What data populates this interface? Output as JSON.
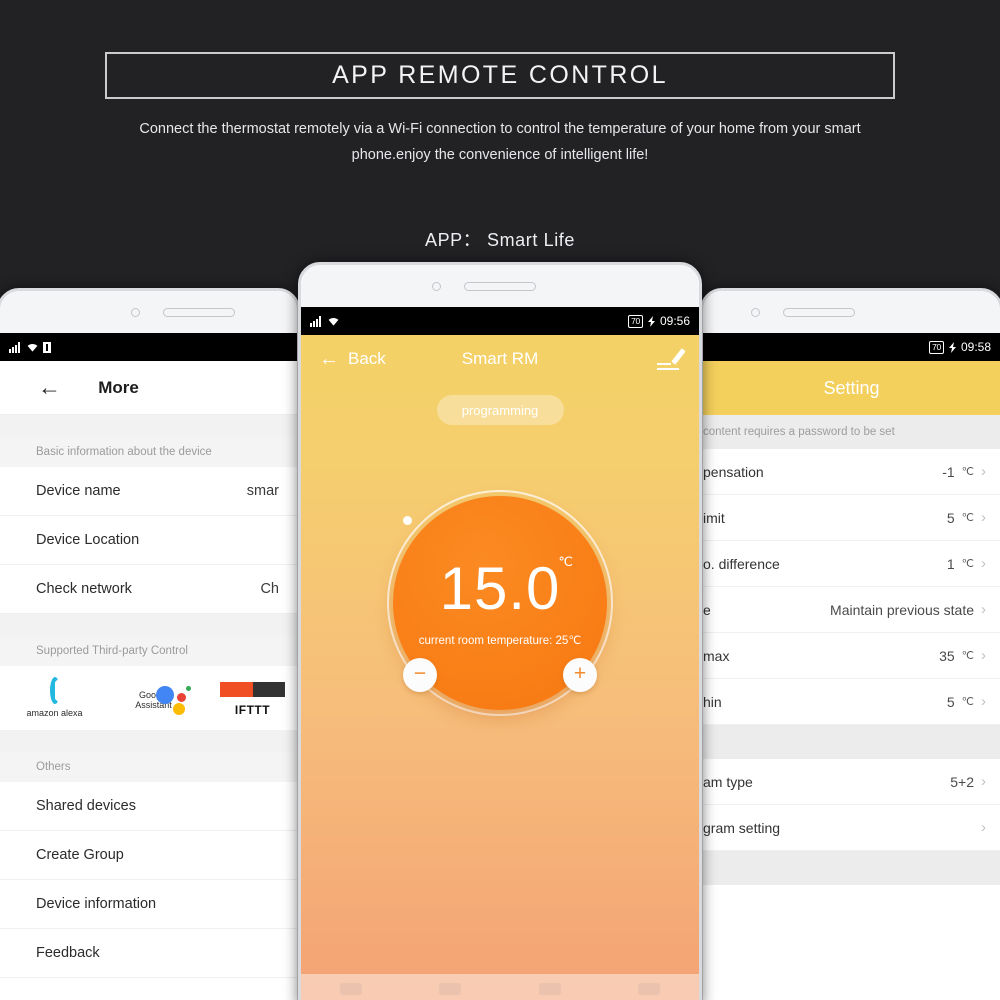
{
  "header": {
    "title": "APP REMOTE CONTROL",
    "subtitle": "Connect the thermostat remotely via a Wi-Fi connection to control the temperature of your home from your smart phone.enjoy the convenience of intelligent life!",
    "app_label": "APP： Smart Life"
  },
  "colors": {
    "background": "#222225",
    "accent_yellow": "#f3cf5c",
    "dial_orange": "#f97d16",
    "border_light": "#c9cbcf"
  },
  "phone_left": {
    "statusbar": {
      "signal": "signal-icon",
      "wifi": "wifi-icon",
      "battery": "battery-icon"
    },
    "back_icon": "←",
    "title": "More",
    "section_basic": "Basic information about the device",
    "rows": [
      {
        "label": "Device name",
        "value": "smar"
      },
      {
        "label": "Device Location",
        "value": ""
      },
      {
        "label": "Check network",
        "value": "Ch"
      }
    ],
    "section_third_party": "Supported Third-party Control",
    "third_party": [
      {
        "name": "amazon alexa",
        "icon": "alexa-icon"
      },
      {
        "name": "Google Assistant",
        "icon": "google-assistant-icon"
      },
      {
        "name": "IFTTT",
        "icon": "ifttt-icon"
      }
    ],
    "section_others": "Others",
    "other_rows": [
      {
        "label": "Shared devices"
      },
      {
        "label": "Create Group"
      },
      {
        "label": "Device information"
      },
      {
        "label": "Feedback"
      }
    ]
  },
  "phone_center": {
    "statusbar": {
      "battery": "70",
      "time": "09:56"
    },
    "back_label": "Back",
    "title": "Smart RM",
    "edit_icon": "edit-pencil-icon",
    "mode_pill": "programming",
    "dial": {
      "setpoint": "15.0",
      "unit": "℃",
      "current_room_label": "current room temperature:",
      "current_room_value": "25℃",
      "minus": "−",
      "plus": "+"
    }
  },
  "phone_right": {
    "statusbar": {
      "battery": "70",
      "time": "09:58"
    },
    "title": "Setting",
    "note": "content requires a password to be set",
    "rows": [
      {
        "label": "pensation",
        "value": "-1",
        "unit": "℃"
      },
      {
        "label": "imit",
        "value": "5",
        "unit": "℃"
      },
      {
        "label": "o. difference",
        "value": "1",
        "unit": "℃"
      },
      {
        "label": "e",
        "value": "Maintain previous state",
        "unit": ""
      },
      {
        "label": "max",
        "value": "35",
        "unit": "℃"
      },
      {
        "label": "hin",
        "value": "5",
        "unit": "℃"
      }
    ],
    "rows2": [
      {
        "label": "am type",
        "value": "5+2",
        "unit": ""
      },
      {
        "label": "gram setting",
        "value": "",
        "unit": ""
      }
    ]
  }
}
